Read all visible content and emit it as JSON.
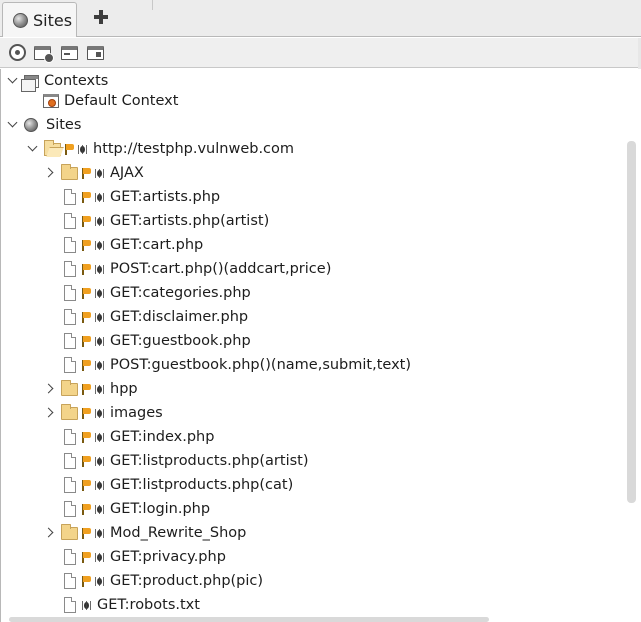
{
  "tab": {
    "label": "Sites",
    "add_tooltip": ""
  },
  "tree": {
    "contexts_label": "Contexts",
    "default_context_label": "Default Context",
    "sites_label": "Sites",
    "host_label": "http://testphp.vulnweb.com",
    "nodes": [
      {
        "label": "AJAX",
        "kind": "folder",
        "expandable": true,
        "flag": true,
        "spider": true
      },
      {
        "label": "GET:artists.php",
        "kind": "page",
        "expandable": false,
        "flag": true,
        "spider": true
      },
      {
        "label": "GET:artists.php(artist)",
        "kind": "page",
        "expandable": false,
        "flag": true,
        "spider": true
      },
      {
        "label": "GET:cart.php",
        "kind": "page",
        "expandable": false,
        "flag": true,
        "spider": true
      },
      {
        "label": "POST:cart.php()(addcart,price)",
        "kind": "page",
        "expandable": false,
        "flag": true,
        "spider": true
      },
      {
        "label": "GET:categories.php",
        "kind": "page",
        "expandable": false,
        "flag": true,
        "spider": true
      },
      {
        "label": "GET:disclaimer.php",
        "kind": "page",
        "expandable": false,
        "flag": true,
        "spider": true
      },
      {
        "label": "GET:guestbook.php",
        "kind": "page",
        "expandable": false,
        "flag": true,
        "spider": true
      },
      {
        "label": "POST:guestbook.php()(name,submit,text)",
        "kind": "page",
        "expandable": false,
        "flag": true,
        "spider": true
      },
      {
        "label": "hpp",
        "kind": "folder",
        "expandable": true,
        "flag": true,
        "spider": true
      },
      {
        "label": "images",
        "kind": "folder",
        "expandable": true,
        "flag": true,
        "spider": true
      },
      {
        "label": "GET:index.php",
        "kind": "page",
        "expandable": false,
        "flag": true,
        "spider": true
      },
      {
        "label": "GET:listproducts.php(artist)",
        "kind": "page",
        "expandable": false,
        "flag": true,
        "spider": true
      },
      {
        "label": "GET:listproducts.php(cat)",
        "kind": "page",
        "expandable": false,
        "flag": true,
        "spider": true
      },
      {
        "label": "GET:login.php",
        "kind": "page",
        "expandable": false,
        "flag": true,
        "spider": true
      },
      {
        "label": "Mod_Rewrite_Shop",
        "kind": "folder",
        "expandable": true,
        "flag": true,
        "spider": true
      },
      {
        "label": "GET:privacy.php",
        "kind": "page",
        "expandable": false,
        "flag": true,
        "spider": true
      },
      {
        "label": "GET:product.php(pic)",
        "kind": "page",
        "expandable": false,
        "flag": true,
        "spider": true
      },
      {
        "label": "GET:robots.txt",
        "kind": "page",
        "expandable": false,
        "flag": false,
        "spider": true
      }
    ]
  }
}
